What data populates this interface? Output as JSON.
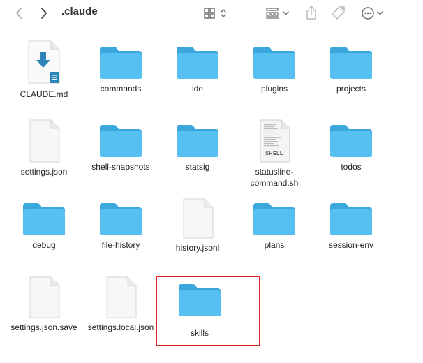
{
  "window": {
    "title": ".claude"
  },
  "toolbar": {
    "back_icon": "chevron-left-icon",
    "forward_icon": "chevron-right-icon",
    "view_icon": "grid-view-icon",
    "group_icon": "group-by-icon",
    "share_icon": "share-icon",
    "tag_icon": "tag-icon",
    "more_icon": "ellipsis-circle-icon"
  },
  "items": [
    {
      "name": "CLAUDE.md",
      "type": "markdown-file"
    },
    {
      "name": "commands",
      "type": "folder"
    },
    {
      "name": "ide",
      "type": "folder"
    },
    {
      "name": "plugins",
      "type": "folder"
    },
    {
      "name": "projects",
      "type": "folder"
    },
    {
      "name": "settings.json",
      "type": "file"
    },
    {
      "name": "shell-snapshots",
      "type": "folder"
    },
    {
      "name": "statsig",
      "type": "folder"
    },
    {
      "name": "statusline-command.sh",
      "type": "shell-file",
      "badge": "SHELL"
    },
    {
      "name": "todos",
      "type": "folder"
    },
    {
      "name": "debug",
      "type": "folder"
    },
    {
      "name": "file-history",
      "type": "folder"
    },
    {
      "name": "history.jsonl",
      "type": "file"
    },
    {
      "name": "plans",
      "type": "folder"
    },
    {
      "name": "session-env",
      "type": "folder"
    },
    {
      "name": "settings.json.save",
      "type": "file"
    },
    {
      "name": "settings.local.json",
      "type": "file"
    },
    {
      "name": "skills",
      "type": "folder",
      "highlighted": true
    }
  ],
  "colors": {
    "folder": "#3db2ea",
    "folder_tab": "#5cc2f0",
    "highlight": "#e02020"
  }
}
